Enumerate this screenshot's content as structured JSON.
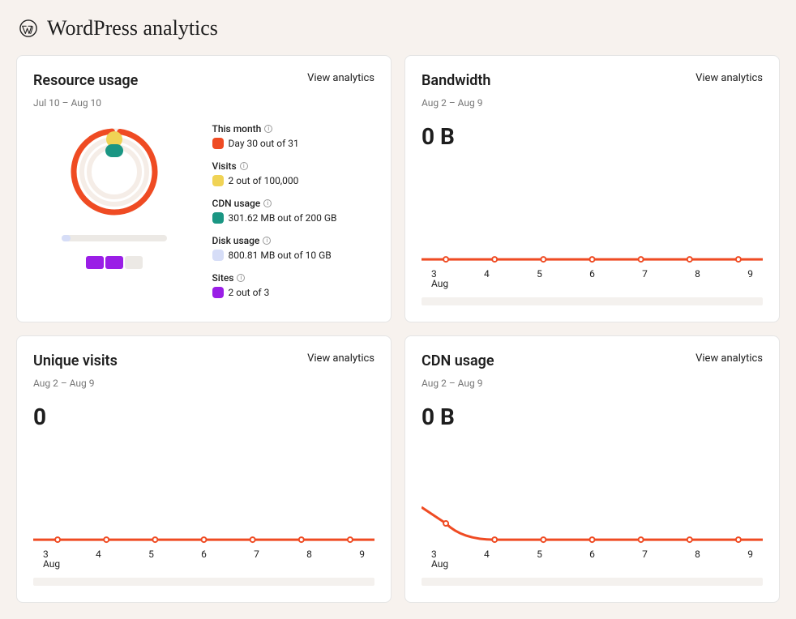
{
  "header": {
    "title": "WordPress analytics"
  },
  "common": {
    "view_label": "View analytics",
    "axis_month": "Aug"
  },
  "colors": {
    "orange": "#ef4b23",
    "yellow": "#f0d355",
    "teal": "#1a9683",
    "lavender": "#d6ddf7",
    "purple": "#9a1ee6"
  },
  "cards": {
    "resource": {
      "title": "Resource usage",
      "range": "Jul 10 – Aug 10",
      "legend": {
        "this_month": {
          "label": "This month",
          "value": "Day 30 out of 31",
          "swatch": "orange"
        },
        "visits": {
          "label": "Visits",
          "value": "2 out of 100,000",
          "swatch": "yellow"
        },
        "cdn": {
          "label": "CDN usage",
          "value": "301.62 MB out of 200 GB",
          "swatch": "teal"
        },
        "disk": {
          "label": "Disk usage",
          "value": "800.81 MB out of 10 GB",
          "swatch": "lavender"
        },
        "sites": {
          "label": "Sites",
          "value": "2 out of 3",
          "swatch": "purple"
        }
      },
      "disk_fill_pct": 8,
      "sites_used": 2,
      "sites_total": 3
    },
    "bandwidth": {
      "title": "Bandwidth",
      "range": "Aug 2 – Aug 9",
      "big_value": "0 B"
    },
    "visits": {
      "title": "Unique visits",
      "range": "Aug 2 – Aug 9",
      "big_value": "0"
    },
    "cdn": {
      "title": "CDN usage",
      "range": "Aug 2 – Aug 9",
      "big_value": "0 B"
    }
  },
  "chart_data": [
    {
      "id": "bandwidth",
      "type": "line",
      "title": "Bandwidth",
      "xlabel": "Aug",
      "ylabel": "",
      "x": [
        2,
        3,
        4,
        5,
        6,
        7,
        8,
        9,
        10
      ],
      "values": [
        0,
        0,
        0,
        0,
        0,
        0,
        0,
        0,
        0
      ],
      "ylim": [
        0,
        1
      ],
      "color": "#ef4b23"
    },
    {
      "id": "unique_visits",
      "type": "line",
      "title": "Unique visits",
      "xlabel": "Aug",
      "ylabel": "",
      "x": [
        2,
        3,
        4,
        5,
        6,
        7,
        8,
        9,
        10
      ],
      "values": [
        0,
        0,
        0,
        0,
        0,
        0,
        0,
        0,
        0
      ],
      "ylim": [
        0,
        1
      ],
      "color": "#ef4b23"
    },
    {
      "id": "cdn_usage",
      "type": "line",
      "title": "CDN usage",
      "xlabel": "Aug",
      "ylabel": "",
      "x": [
        2,
        3,
        4,
        5,
        6,
        7,
        8,
        9,
        10
      ],
      "values": [
        0.9,
        0.5,
        0,
        0,
        0,
        0,
        0,
        0,
        0
      ],
      "ylim": [
        0,
        1
      ],
      "color": "#ef4b23"
    },
    {
      "id": "resource_usage_rings",
      "type": "pie",
      "title": "Resource usage",
      "series": [
        {
          "name": "This month",
          "value": 30,
          "max": 31,
          "color": "#ef4b23"
        },
        {
          "name": "Visits",
          "value": 2,
          "max": 100000,
          "color": "#f0d355"
        },
        {
          "name": "CDN usage (MB)",
          "value": 301.62,
          "max": 204800,
          "color": "#1a9683"
        },
        {
          "name": "Disk usage (MB)",
          "value": 800.81,
          "max": 10240,
          "color": "#d6ddf7"
        },
        {
          "name": "Sites",
          "value": 2,
          "max": 3,
          "color": "#9a1ee6"
        }
      ]
    }
  ],
  "axis_ticks": [
    "3",
    "4",
    "5",
    "6",
    "7",
    "8",
    "9"
  ]
}
